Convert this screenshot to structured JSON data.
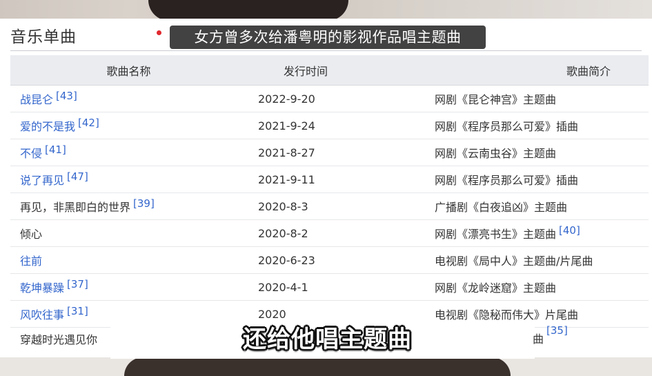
{
  "top_caption": "女方曾多次给潘粤明的影视作品唱主题曲",
  "section_title": "音乐单曲",
  "table": {
    "headers": [
      "歌曲名称",
      "发行时间",
      "歌曲简介"
    ],
    "rows": [
      {
        "name": "战昆仑",
        "name_ref": "[43]",
        "date": "2022-9-20",
        "intro": "网剧《昆仑神宫》主题曲",
        "intro_ref": ""
      },
      {
        "name": "爱的不是我",
        "name_ref": "[42]",
        "date": "2021-9-24",
        "intro": "网剧《程序员那么可爱》插曲",
        "intro_ref": ""
      },
      {
        "name": "不侵",
        "name_ref": "[41]",
        "date": "2021-8-27",
        "intro": "网剧《云南虫谷》主题曲",
        "intro_ref": ""
      },
      {
        "name": "说了再见",
        "name_ref": "[47]",
        "date": "2021-9-11",
        "intro": "网剧《程序员那么可爱》插曲",
        "intro_ref": ""
      },
      {
        "name": "再见，非黑即白的世界",
        "name_ref": "[39]",
        "date": "2020-8-3",
        "intro": "广播剧《白夜追凶》主题曲",
        "intro_ref": ""
      },
      {
        "name": "倾心",
        "name_ref": "",
        "date": "2020-8-2",
        "intro": "网剧《漂亮书生》主题曲",
        "intro_ref": "[40]"
      },
      {
        "name": "往前",
        "name_ref": "",
        "date": "2020-6-23",
        "intro": "电视剧《局中人》主题曲/片尾曲",
        "intro_ref": ""
      },
      {
        "name": "乾坤暴躁",
        "name_ref": "[37]",
        "date": "2020-4-1",
        "intro": "网剧《龙岭迷窟》主题曲",
        "intro_ref": ""
      },
      {
        "name": "风吹往事",
        "name_ref": "[31]",
        "date": "2020",
        "intro": "电视剧《隐秘而伟大》片尾曲",
        "intro_ref": ""
      }
    ],
    "last_row": {
      "name": "穿越时光遇见你",
      "intro_tail": "曲",
      "intro_ref": "[35]"
    }
  },
  "bottom_caption": "还给他唱主题曲",
  "colors": {
    "link": "#3366cc",
    "header_bg": "#eaecf0",
    "caption_bg": "#282828"
  }
}
